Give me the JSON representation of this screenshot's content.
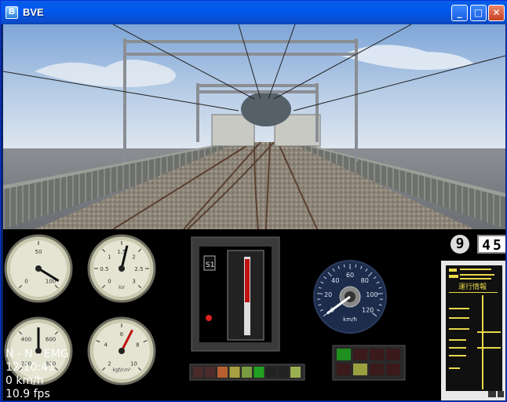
{
  "window": {
    "title": "BVE",
    "buttons": {
      "minimize": "_",
      "maximize": "□",
      "close": "✕"
    }
  },
  "hud": {
    "signal_status": "N - N - EMG",
    "clock": "12:10:41",
    "speed": "0 km/h",
    "fps": "10.9 fps"
  },
  "gauges": [
    {
      "name": "gauge-brake-cylinder",
      "ticks": [
        "0",
        "50",
        "100"
      ],
      "unit": "",
      "needle_fraction": 0.95
    },
    {
      "name": "gauge-voltage",
      "ticks": [
        "0",
        "0.5",
        "1",
        "1.5",
        "2",
        "2.5",
        "3"
      ],
      "unit": "kV",
      "needle_fraction": 0.55
    },
    {
      "name": "gauge-pressure-1",
      "ticks": [
        "200",
        "400",
        "600",
        "800"
      ],
      "unit": "",
      "needle_fraction": 0.5
    },
    {
      "name": "gauge-pressure-2",
      "ticks": [
        "2",
        "4",
        "6",
        "8",
        "10"
      ],
      "unit": "kgf/cm²",
      "needle_fraction": 0.6
    }
  ],
  "speedometer": {
    "ticks": [
      "0",
      "20",
      "40",
      "60",
      "80",
      "100",
      "120"
    ],
    "unit": "km/h",
    "value": 0
  },
  "notch_indicator": {
    "label": "S1"
  },
  "brake_lamps": {
    "colors": [
      "#4a2a2a",
      "#4a2a2a",
      "#b86030",
      "#a8a040",
      "#7a9a40",
      "#20a020",
      "#222222",
      "#222222",
      "#9ab050"
    ]
  },
  "status_lamps": {
    "colors": [
      "#1f8f1f",
      "#3a1a1a",
      "#3a1a1a",
      "#3a1a1a",
      "#3a1a1a",
      "#9aa040",
      "#3a1a1a",
      "#3a1a1a"
    ]
  },
  "counter": {
    "digit": "9",
    "minutes": "45"
  },
  "ti_display": {
    "title": "運行情報",
    "colors": {
      "bg": "#101010",
      "text": "#e8d84a"
    }
  }
}
